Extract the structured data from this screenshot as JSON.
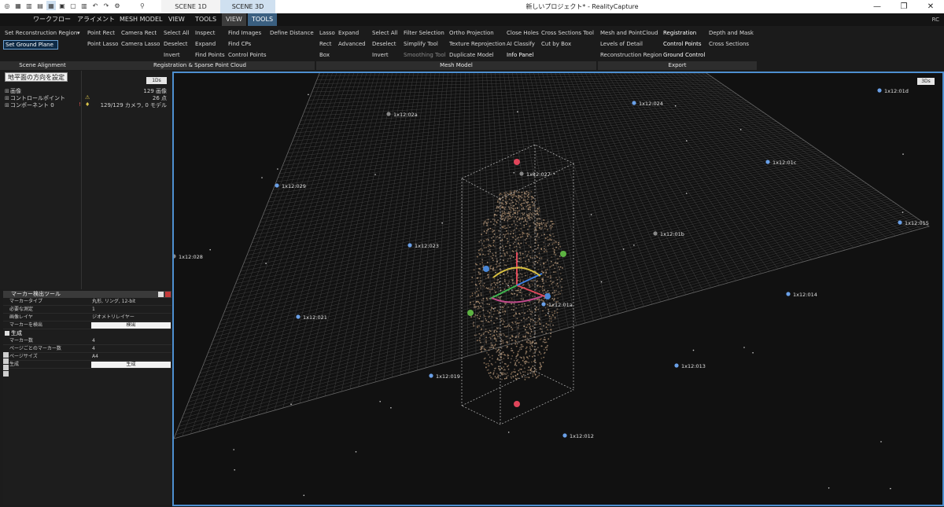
{
  "titlebar": {
    "app_title": "新しいプロジェクト* - RealityCapture",
    "scene_tabs": [
      "SCENE 1D",
      "SCENE 3D"
    ],
    "window_controls": [
      "—",
      "❐",
      "✕"
    ]
  },
  "menubar": {
    "items": [
      "ワークフロー",
      "アライメント",
      "MESH MODEL",
      "VIEW",
      "TOOLS",
      "VIEW",
      "TOOLS"
    ],
    "rc": "RC"
  },
  "ribbon": {
    "scene_alignment": {
      "set_reconstruction_region": "Set Reconstruction Region",
      "set_ground_plane": "Set Ground Plane",
      "label": "Scene Alignment"
    },
    "registration": {
      "point_rect": "Point Rect",
      "camera_rect": "Camera Rect",
      "point_lasso": "Point Lasso",
      "camera_lasso": "Camera Lasso",
      "select_all": "Select All",
      "deselect": "Deselect",
      "invert": "Invert",
      "inspect": "Inspect",
      "expand": "Expand",
      "find_points": "Find Points",
      "find_images": "Find Images",
      "find_cps": "Find CPs",
      "control_points": "Control Points",
      "define_distance": "Define Distance",
      "label": "Registration & Sparse Point Cloud"
    },
    "mesh_model": {
      "lasso": "Lasso",
      "rect": "Rect",
      "box": "Box",
      "expand": "Expand",
      "advanced": "Advanced",
      "select_all": "Select All",
      "deselect": "Deselect",
      "invert": "Invert",
      "filter_selection": "Filter Selection",
      "simplify_tool": "Simplify Tool",
      "smoothing_tool": "Smoothing Tool",
      "ortho_projection": "Ortho Projection",
      "texture_reprojection": "Texture Reprojection",
      "duplicate_model": "Duplicate Model",
      "close_holes": "Close Holes",
      "ai_classify": "AI Classify",
      "info_panel": "Info Panel",
      "cross_sections_tool": "Cross Sections Tool",
      "cut_by_box": "Cut by Box",
      "label": "Mesh Model"
    },
    "export": {
      "mesh_and_pointcloud": "Mesh and PointCloud",
      "levels_of_detail": "Levels of Detail",
      "reconstruction_region": "Reconstruction Region",
      "registration": "Registration",
      "control_points": "Control Points",
      "ground_control": "Ground Control",
      "depth_and_mask": "Depth and Mask",
      "cross_sections": "Cross Sections",
      "label": "Export"
    }
  },
  "left_panel": {
    "tooltip": "地平面の方向を設定",
    "tree": [
      {
        "label": "画像",
        "value": "129 画像"
      },
      {
        "label": "コントロールポイント",
        "value": "26 点"
      },
      {
        "label": "コンポーネント 0",
        "value": "129/129 カメラ, 0 モデル"
      }
    ],
    "btn_1ds": "1Ds"
  },
  "tool_panel": {
    "title": "マーカー検出ツール",
    "rows": [
      {
        "key": "マーカータイプ",
        "value": "丸形, リング, 12-bit"
      },
      {
        "key": "必要な測定",
        "value": "1"
      },
      {
        "key": "画像レイヤ",
        "value": "ジオメトリレイヤー"
      }
    ],
    "detect_label": "マーカーを検出",
    "detect_button": "検出",
    "section": "生成",
    "gen_rows": [
      {
        "key": "マーカー数",
        "value": "4"
      },
      {
        "key": "ページごとのマーカー数",
        "value": "4"
      },
      {
        "key": "ページサイズ",
        "value": "A4"
      }
    ],
    "generate_label": "生成",
    "generate_button": "生成"
  },
  "viewport": {
    "btn_3ds": "3Ds",
    "markers": [
      {
        "label": "1x12:024",
        "color": "#6aa0e8"
      },
      {
        "label": "1x12:01d",
        "color": "#6aa0e8"
      },
      {
        "label": "1x12:02a",
        "color": "#888888"
      },
      {
        "label": "1x12:01c",
        "color": "#6aa0e8"
      },
      {
        "label": "1x12:027",
        "color": "#888888"
      },
      {
        "label": "1x12:029",
        "color": "#6aa0e8"
      },
      {
        "label": "1x12:015",
        "color": "#6aa0e8"
      },
      {
        "label": "1x12:01b",
        "color": "#888888"
      },
      {
        "label": "1x12:023",
        "color": "#6aa0e8"
      },
      {
        "label": "1x12:028",
        "color": "#888888"
      },
      {
        "label": "1x12:01a",
        "color": "#6aa0e8"
      },
      {
        "label": "1x12:014",
        "color": "#6aa0e8"
      },
      {
        "label": "1x12:021",
        "color": "#6aa0e8"
      },
      {
        "label": "1x12:013",
        "color": "#6aa0e8"
      },
      {
        "label": "1x12:019",
        "color": "#6aa0e8"
      },
      {
        "label": "1x12:012",
        "color": "#6aa0e8"
      }
    ]
  }
}
